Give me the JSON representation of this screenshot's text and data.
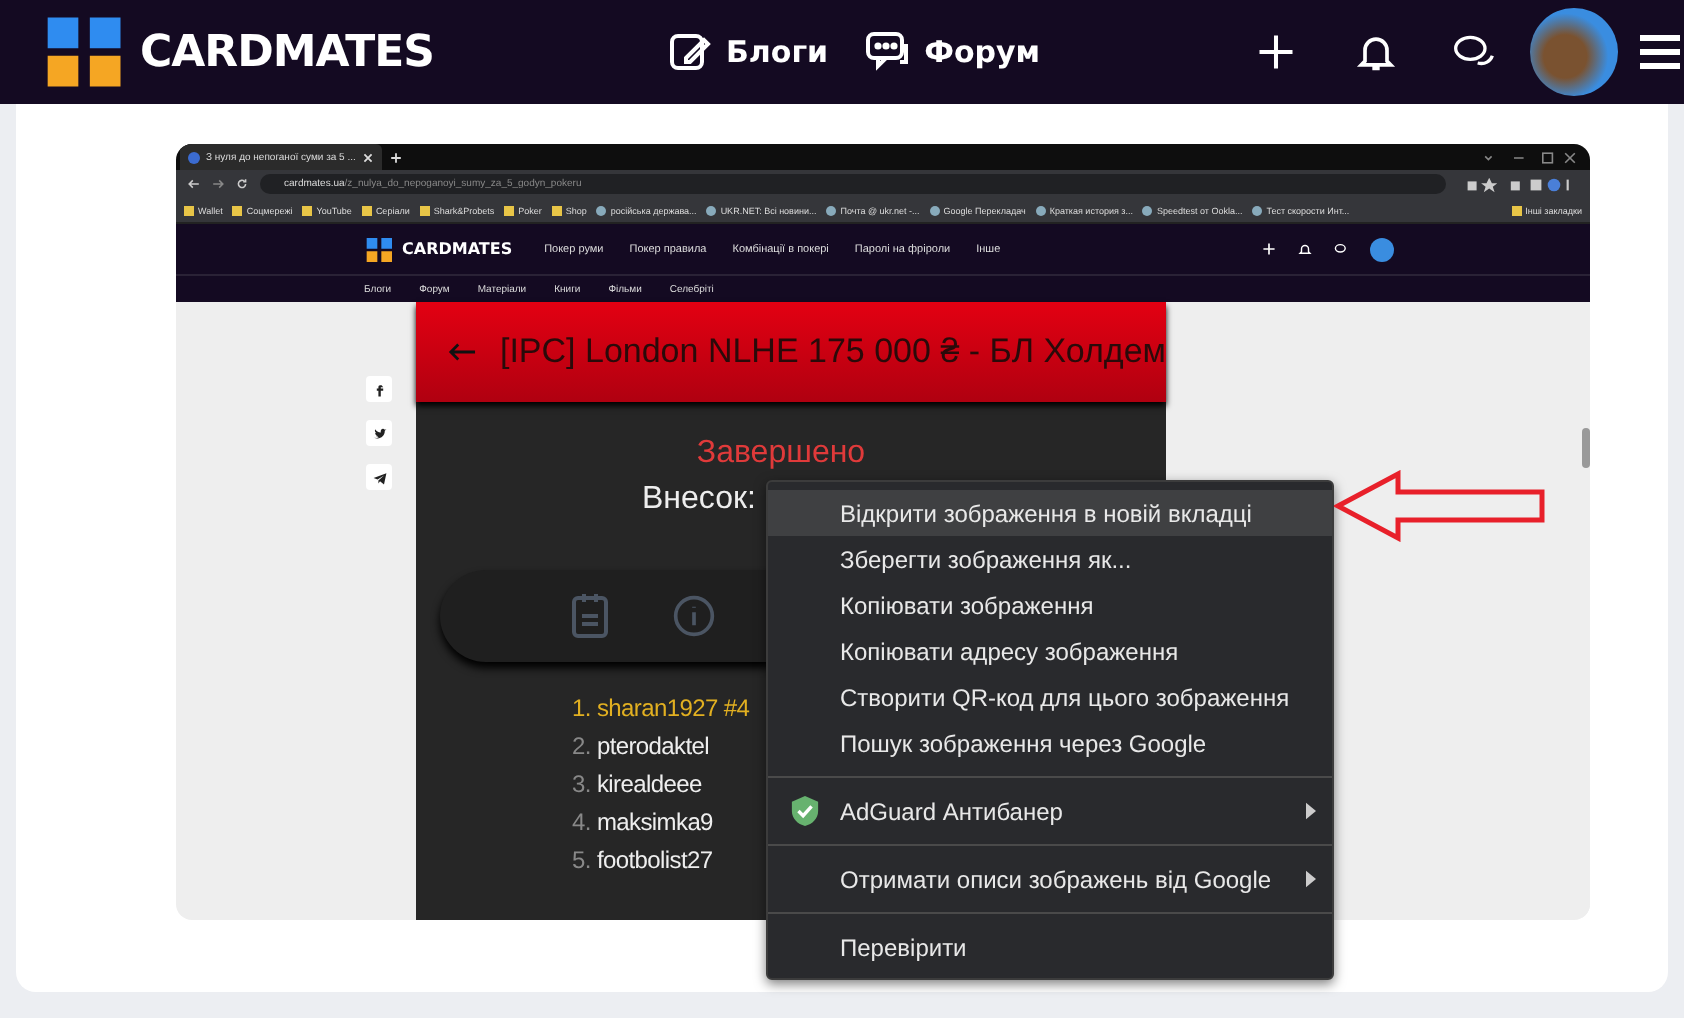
{
  "header": {
    "logo": "CARDMATES",
    "nav": [
      {
        "label": "Блоги"
      },
      {
        "label": "Форум"
      }
    ]
  },
  "screenshot": {
    "tab": {
      "title": "З нуля до непоганої суми за 5 ..."
    },
    "address": {
      "domain": "cardmates.ua",
      "path": "/z_nulya_do_nepoganoyi_sumy_za_5_godyn_pokeru"
    },
    "bookmarks": [
      {
        "label": "Wallet",
        "kind": "folder"
      },
      {
        "label": "Соцмережі",
        "kind": "folder"
      },
      {
        "label": "YouTube",
        "kind": "folder"
      },
      {
        "label": "Серіали",
        "kind": "folder"
      },
      {
        "label": "Shark&Probets",
        "kind": "folder"
      },
      {
        "label": "Poker",
        "kind": "folder"
      },
      {
        "label": "Shop",
        "kind": "folder"
      },
      {
        "label": "російська держава...",
        "kind": "site"
      },
      {
        "label": "UKR.NET: Всі новини...",
        "kind": "site"
      },
      {
        "label": "Почта @ ukr.net -...",
        "kind": "site"
      },
      {
        "label": "Google Перекладач",
        "kind": "site"
      },
      {
        "label": "Краткая история з...",
        "kind": "site"
      },
      {
        "label": "Speedtest от Ookla...",
        "kind": "site"
      },
      {
        "label": "Тест скорости Инт...",
        "kind": "site"
      }
    ],
    "other_bookmarks": "Інші закладки",
    "site": {
      "logo": "CARDMATES",
      "menu": [
        "Покер руми",
        "Покер правила",
        "Комбінації в покері",
        "Паролі на фріроли",
        "Інше"
      ],
      "subnav": [
        "Блоги",
        "Форум",
        "Матеріали",
        "Книги",
        "Фільми",
        "Селебріті"
      ]
    },
    "tournament": {
      "title": "[IPC] London NLHE 175 000 ₴ - БЛ Холдем",
      "status": "Завершено",
      "contribution_label": "Внесок:",
      "players": [
        {
          "rank": "1.",
          "name": "sharan1927 #4",
          "highlighted": true
        },
        {
          "rank": "2.",
          "name": "pterodaktel",
          "highlighted": false
        },
        {
          "rank": "3.",
          "name": "kirealdeee",
          "highlighted": false
        },
        {
          "rank": "4.",
          "name": "maksimka9",
          "highlighted": false
        },
        {
          "rank": "5.",
          "name": "footbolist27",
          "highlighted": false
        }
      ]
    }
  },
  "context_menu": {
    "groups": [
      [
        {
          "label": "Відкрити зображення в новій вкладці",
          "selected": true,
          "submenu": false
        },
        {
          "label": "Зберегти зображення як...",
          "selected": false,
          "submenu": false
        },
        {
          "label": "Копіювати зображення",
          "selected": false,
          "submenu": false
        },
        {
          "label": "Копіювати адресу зображення",
          "selected": false,
          "submenu": false
        },
        {
          "label": "Створити QR-код для цього зображення",
          "selected": false,
          "submenu": false
        },
        {
          "label": "Пошук зображення через Google",
          "selected": false,
          "submenu": false
        }
      ],
      [
        {
          "label": "AdGuard Антибанер",
          "selected": false,
          "submenu": true,
          "kind": "extension"
        }
      ],
      [
        {
          "label": "Отримати описи зображень від Google",
          "selected": false,
          "submenu": true
        }
      ],
      [
        {
          "label": "Перевірити",
          "selected": false,
          "submenu": false
        }
      ]
    ]
  }
}
